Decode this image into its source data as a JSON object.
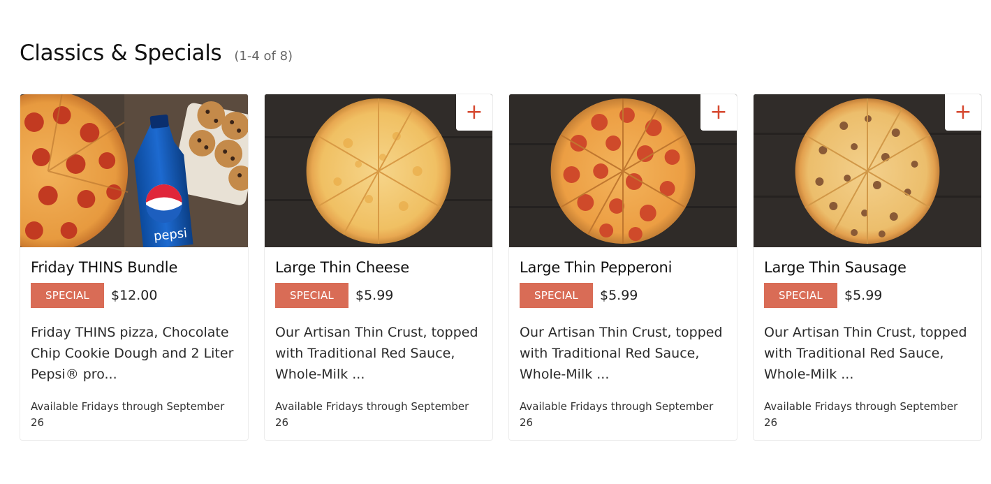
{
  "section": {
    "title": "Classics & Specials",
    "count": "(1-4 of 8)"
  },
  "cards": [
    {
      "title": "Friday THINS Bundle",
      "badge": "SPECIAL",
      "price": "$12.00",
      "description": "Friday THINS pizza, Chocolate Chip Cookie Dough and 2 Liter Pepsi® pro...",
      "availability": "Available Fridays through September 26",
      "image": "pizza-pepsi-cookies",
      "has_add_button": false
    },
    {
      "title": "Large Thin Cheese",
      "badge": "SPECIAL",
      "price": "$5.99",
      "description": "Our Artisan Thin Crust, topped with Traditional Red Sauce, Whole-Milk ...",
      "availability": "Available Fridays through September 26",
      "image": "cheese-pizza",
      "has_add_button": true,
      "add_label": "+"
    },
    {
      "title": "Large Thin Pepperoni",
      "badge": "SPECIAL",
      "price": "$5.99",
      "description": "Our Artisan Thin Crust, topped with Traditional Red Sauce, Whole-Milk ...",
      "availability": "Available Fridays through September 26",
      "image": "pepperoni-pizza",
      "has_add_button": true,
      "add_label": "+"
    },
    {
      "title": "Large Thin Sausage",
      "badge": "SPECIAL",
      "price": "$5.99",
      "description": "Our Artisan Thin Crust, topped with Traditional Red Sauce, Whole-Milk ...",
      "availability": "Available Fridays through September 26",
      "image": "sausage-pizza",
      "has_add_button": true,
      "add_label": "+"
    }
  ],
  "colors": {
    "accent": "#d6482f",
    "badge": "#d96c56"
  }
}
